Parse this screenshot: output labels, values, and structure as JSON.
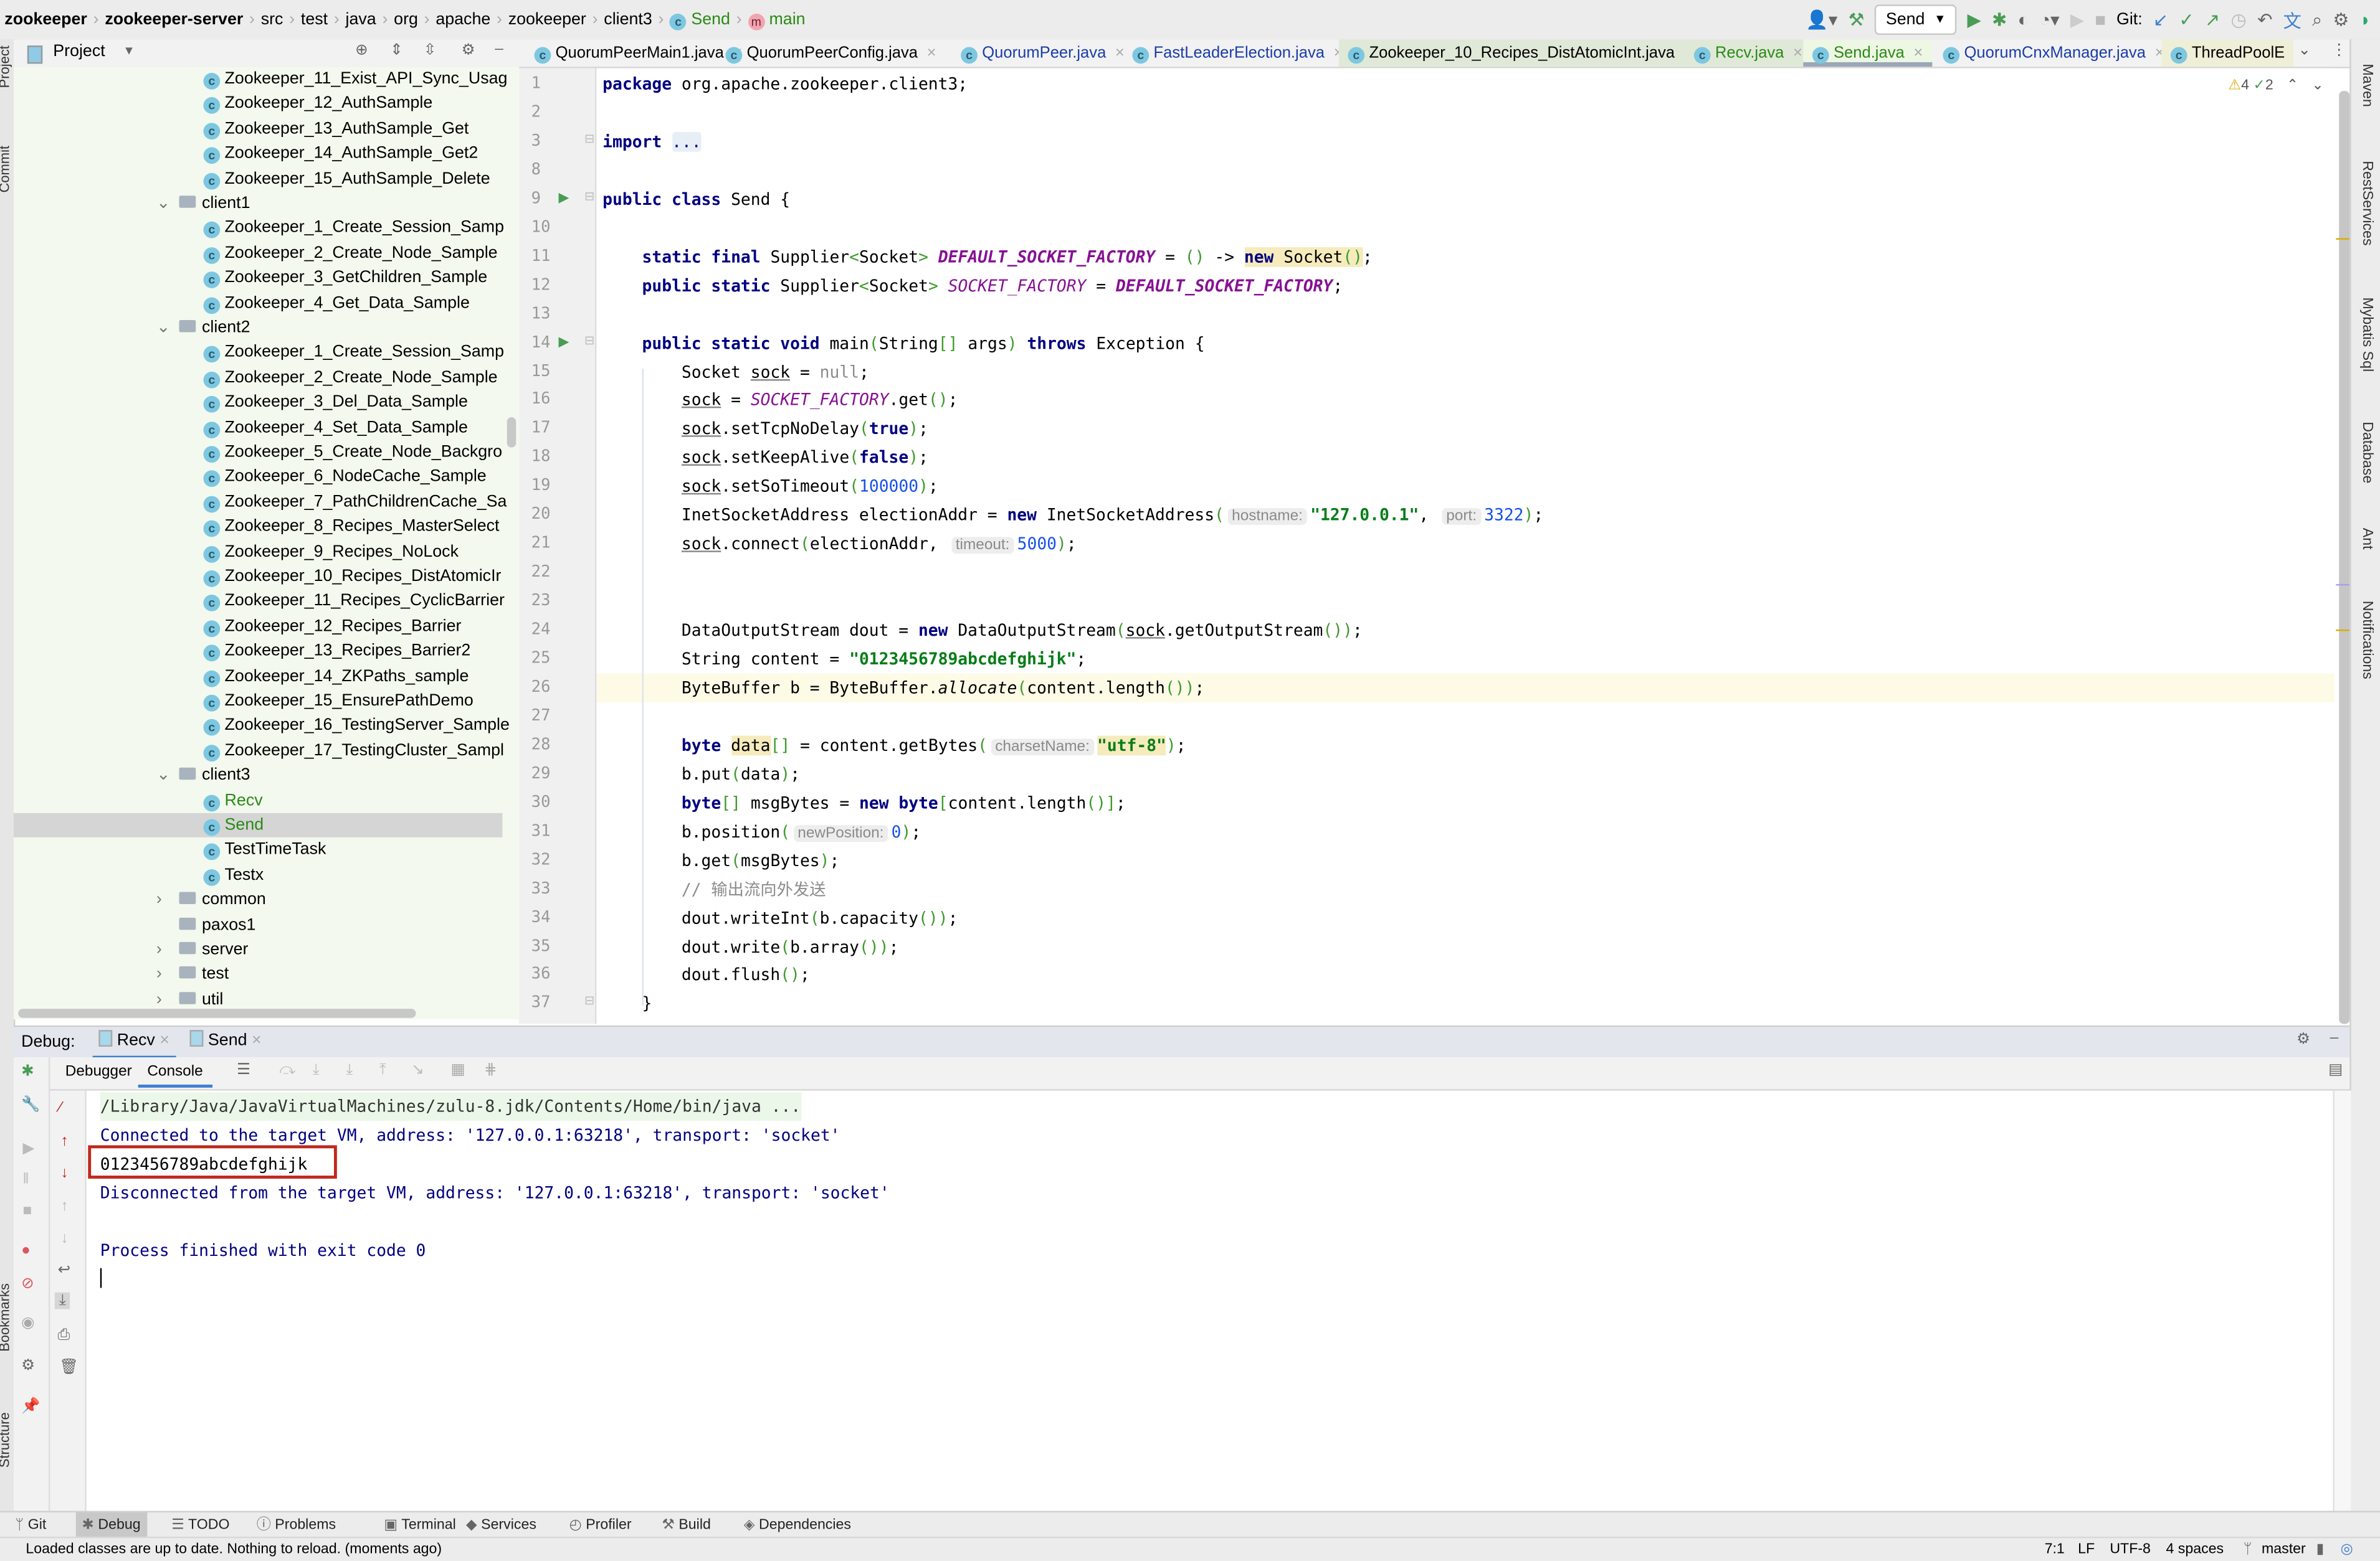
{
  "breadcrumb": [
    "zookeeper",
    "zookeeper-server",
    "src",
    "test",
    "java",
    "org",
    "apache",
    "zookeeper",
    "client3",
    "Send",
    "main"
  ],
  "toolbar": {
    "run_config": "Send",
    "git_label": "Git:"
  },
  "project_panel": {
    "title": "Project"
  },
  "tree": [
    {
      "label": "Zookeeper_11_Exist_API_Sync_Usag",
      "type": "class",
      "level": 2
    },
    {
      "label": "Zookeeper_12_AuthSample",
      "type": "class",
      "level": 2
    },
    {
      "label": "Zookeeper_13_AuthSample_Get",
      "type": "class",
      "level": 2
    },
    {
      "label": "Zookeeper_14_AuthSample_Get2",
      "type": "class",
      "level": 2
    },
    {
      "label": "Zookeeper_15_AuthSample_Delete",
      "type": "class",
      "level": 2
    },
    {
      "label": "client1",
      "type": "folder-open",
      "level": 1
    },
    {
      "label": "Zookeeper_1_Create_Session_Samp",
      "type": "class",
      "level": 2
    },
    {
      "label": "Zookeeper_2_Create_Node_Sample",
      "type": "class",
      "level": 2
    },
    {
      "label": "Zookeeper_3_GetChildren_Sample",
      "type": "class",
      "level": 2
    },
    {
      "label": "Zookeeper_4_Get_Data_Sample",
      "type": "class",
      "level": 2
    },
    {
      "label": "client2",
      "type": "folder-open",
      "level": 1
    },
    {
      "label": "Zookeeper_1_Create_Session_Samp",
      "type": "class",
      "level": 2
    },
    {
      "label": "Zookeeper_2_Create_Node_Sample",
      "type": "class",
      "level": 2
    },
    {
      "label": "Zookeeper_3_Del_Data_Sample",
      "type": "class",
      "level": 2
    },
    {
      "label": "Zookeeper_4_Set_Data_Sample",
      "type": "class",
      "level": 2
    },
    {
      "label": "Zookeeper_5_Create_Node_Backgro",
      "type": "class",
      "level": 2
    },
    {
      "label": "Zookeeper_6_NodeCache_Sample",
      "type": "class",
      "level": 2
    },
    {
      "label": "Zookeeper_7_PathChildrenCache_Sa",
      "type": "class",
      "level": 2
    },
    {
      "label": "Zookeeper_8_Recipes_MasterSelect",
      "type": "class",
      "level": 2
    },
    {
      "label": "Zookeeper_9_Recipes_NoLock",
      "type": "class",
      "level": 2
    },
    {
      "label": "Zookeeper_10_Recipes_DistAtomicIr",
      "type": "class",
      "level": 2
    },
    {
      "label": "Zookeeper_11_Recipes_CyclicBarrier",
      "type": "class",
      "level": 2
    },
    {
      "label": "Zookeeper_12_Recipes_Barrier",
      "type": "class",
      "level": 2
    },
    {
      "label": "Zookeeper_13_Recipes_Barrier2",
      "type": "class",
      "level": 2
    },
    {
      "label": "Zookeeper_14_ZKPaths_sample",
      "type": "class",
      "level": 2
    },
    {
      "label": "Zookeeper_15_EnsurePathDemo",
      "type": "class",
      "level": 2
    },
    {
      "label": "Zookeeper_16_TestingServer_Sample",
      "type": "class",
      "level": 2
    },
    {
      "label": "Zookeeper_17_TestingCluster_Sampl",
      "type": "class",
      "level": 2
    },
    {
      "label": "client3",
      "type": "folder-open",
      "level": 1
    },
    {
      "label": "Recv",
      "type": "class-green",
      "level": 2
    },
    {
      "label": "Send",
      "type": "class-green",
      "level": 2,
      "selected": true
    },
    {
      "label": "TestTimeTask",
      "type": "class",
      "level": 2
    },
    {
      "label": "Testx",
      "type": "class",
      "level": 2
    },
    {
      "label": "common",
      "type": "folder-closed",
      "level": 1
    },
    {
      "label": "paxos1",
      "type": "folder",
      "level": 1
    },
    {
      "label": "server",
      "type": "folder-closed",
      "level": 1
    },
    {
      "label": "test",
      "type": "folder-closed",
      "level": 1
    },
    {
      "label": "util",
      "type": "folder-closed",
      "level": 1
    }
  ],
  "tabs": [
    {
      "label": "QuorumPeerMain1.java",
      "color": "#000000"
    },
    {
      "label": "QuorumPeerConfig.java",
      "color": "#000000"
    },
    {
      "label": "QuorumPeer.java",
      "color": "#1a3da8"
    },
    {
      "label": "FastLeaderElection.java",
      "color": "#1a3da8"
    },
    {
      "label": "Zookeeper_10_Recipes_DistAtomicInt.java",
      "color": "#000000",
      "bg": "#e0e9d8"
    },
    {
      "label": "Recv.java",
      "color": "#2a8a16",
      "bg": "#e0e9d8"
    },
    {
      "label": "Send.java",
      "color": "#2a8a16",
      "active": true
    },
    {
      "label": "QuorumCnxManager.java",
      "color": "#1a3da8"
    },
    {
      "label": "ThreadPoolE",
      "color": "#000000",
      "bg": "#efefd8"
    }
  ],
  "inspections": {
    "warnings": "4",
    "ok": "2"
  },
  "code": [
    {
      "n": "1",
      "t": [
        [
          "package",
          "k"
        ],
        [
          " org.apache.zookeeper.client3;",
          ""
        ]
      ]
    },
    {
      "n": "2",
      "t": []
    },
    {
      "n": "3",
      "t": [
        [
          "import",
          "k"
        ],
        [
          " ",
          ""
        ],
        [
          "...",
          "fold"
        ]
      ]
    },
    {
      "n": "8",
      "t": []
    },
    {
      "n": "9",
      "run": true,
      "t": [
        [
          "public class",
          "k"
        ],
        [
          " Send ",
          ""
        ],
        [
          "{",
          ""
        ]
      ]
    },
    {
      "n": "10",
      "t": []
    },
    {
      "n": "11",
      "t": [
        [
          "    ",
          ""
        ],
        [
          "static final",
          "k"
        ],
        [
          " Supplier",
          ""
        ],
        [
          "<",
          "p"
        ],
        [
          "Socket",
          ""
        ],
        [
          ">",
          "p"
        ],
        [
          " ",
          ""
        ],
        [
          "DEFAULT_SOCKET_FACTORY",
          "fb"
        ],
        [
          " = ",
          ""
        ],
        [
          "()",
          "p"
        ],
        [
          " -> ",
          ""
        ],
        [
          "new",
          "k hl"
        ],
        [
          " Socket",
          "hl"
        ],
        [
          "()",
          "p hl"
        ],
        [
          ";",
          ""
        ]
      ]
    },
    {
      "n": "12",
      "t": [
        [
          "    ",
          ""
        ],
        [
          "public static",
          "k"
        ],
        [
          " Supplier",
          ""
        ],
        [
          "<",
          "p"
        ],
        [
          "Socket",
          ""
        ],
        [
          ">",
          "p"
        ],
        [
          " ",
          ""
        ],
        [
          "SOCKET_FACTORY",
          "f"
        ],
        [
          " = ",
          ""
        ],
        [
          "DEFAULT_SOCKET_FACTORY",
          "fb"
        ],
        [
          ";",
          ""
        ]
      ]
    },
    {
      "n": "13",
      "t": []
    },
    {
      "n": "14",
      "run": true,
      "t": [
        [
          "    ",
          ""
        ],
        [
          "public static void",
          "k"
        ],
        [
          " main",
          ""
        ],
        [
          "(",
          "p"
        ],
        [
          "String",
          ""
        ],
        [
          "[]",
          "p"
        ],
        [
          " args",
          ""
        ],
        [
          ")",
          "p"
        ],
        [
          " ",
          ""
        ],
        [
          "throws",
          "k"
        ],
        [
          " Exception ",
          ""
        ],
        [
          "{",
          ""
        ]
      ]
    },
    {
      "n": "15",
      "t": [
        [
          "        Socket ",
          ""
        ],
        [
          "sock",
          "u"
        ],
        [
          " = ",
          ""
        ],
        [
          "null",
          "nl"
        ],
        [
          ";",
          ""
        ]
      ]
    },
    {
      "n": "16",
      "t": [
        [
          "        ",
          ""
        ],
        [
          "sock",
          "u"
        ],
        [
          " = ",
          ""
        ],
        [
          "SOCKET_FACTORY",
          "f"
        ],
        [
          ".get",
          ""
        ],
        [
          "()",
          "p"
        ],
        [
          ";",
          ""
        ]
      ]
    },
    {
      "n": "17",
      "t": [
        [
          "        ",
          ""
        ],
        [
          "sock",
          "u"
        ],
        [
          ".setTcpNoDelay",
          ""
        ],
        [
          "(",
          "p"
        ],
        [
          "true",
          "k"
        ],
        [
          ")",
          "p"
        ],
        [
          ";",
          ""
        ]
      ]
    },
    {
      "n": "18",
      "t": [
        [
          "        ",
          ""
        ],
        [
          "sock",
          "u"
        ],
        [
          ".setKeepAlive",
          ""
        ],
        [
          "(",
          "p"
        ],
        [
          "false",
          "k"
        ],
        [
          ")",
          "p"
        ],
        [
          ";",
          ""
        ]
      ]
    },
    {
      "n": "19",
      "t": [
        [
          "        ",
          ""
        ],
        [
          "sock",
          "u"
        ],
        [
          ".setSoTimeout",
          ""
        ],
        [
          "(",
          "p"
        ],
        [
          "100000",
          "n"
        ],
        [
          ")",
          "p"
        ],
        [
          ";",
          ""
        ]
      ]
    },
    {
      "n": "20",
      "t": [
        [
          "        InetSocketAddress electionAddr = ",
          ""
        ],
        [
          "new",
          "k"
        ],
        [
          " InetSocketAddress",
          ""
        ],
        [
          "(",
          "p"
        ],
        [
          "hostname:",
          "h"
        ],
        [
          "\"127.0.0.1\"",
          "s"
        ],
        [
          ", ",
          ""
        ],
        [
          "port:",
          "h"
        ],
        [
          "3322",
          "n"
        ],
        [
          ")",
          "p"
        ],
        [
          ";",
          ""
        ]
      ]
    },
    {
      "n": "21",
      "t": [
        [
          "        ",
          ""
        ],
        [
          "sock",
          "u"
        ],
        [
          ".connect",
          ""
        ],
        [
          "(",
          "p"
        ],
        [
          "electionAddr, ",
          ""
        ],
        [
          "timeout:",
          "h"
        ],
        [
          "5000",
          "n"
        ],
        [
          ")",
          "p"
        ],
        [
          ";",
          ""
        ]
      ]
    },
    {
      "n": "22",
      "t": []
    },
    {
      "n": "23",
      "t": []
    },
    {
      "n": "24",
      "t": [
        [
          "        DataOutputStream dout = ",
          ""
        ],
        [
          "new",
          "k"
        ],
        [
          " DataOutputStream",
          ""
        ],
        [
          "(",
          "p"
        ],
        [
          "sock",
          "u"
        ],
        [
          ".getOutputStream",
          ""
        ],
        [
          "()",
          "p"
        ],
        [
          ")",
          "p"
        ],
        [
          ";",
          ""
        ]
      ]
    },
    {
      "n": "25",
      "t": [
        [
          "        String content = ",
          ""
        ],
        [
          "\"0123456789abcdefghijk\"",
          "s"
        ],
        [
          ";",
          ""
        ]
      ]
    },
    {
      "n": "26",
      "cur": true,
      "bulb": true,
      "t": [
        [
          "        ByteBuffer b = ByteBuffer.",
          ""
        ],
        [
          "allocate",
          "i"
        ],
        [
          "(",
          "p"
        ],
        [
          "content.length",
          ""
        ],
        [
          "()",
          "p"
        ],
        [
          ")",
          "p"
        ],
        [
          ";",
          ""
        ]
      ]
    },
    {
      "n": "27",
      "t": []
    },
    {
      "n": "28",
      "t": [
        [
          "        ",
          ""
        ],
        [
          "byte",
          "k"
        ],
        [
          " ",
          ""
        ],
        [
          "data",
          "hl"
        ],
        [
          "[]",
          "p"
        ],
        [
          " = content.getBytes",
          ""
        ],
        [
          "(",
          "p"
        ],
        [
          "charsetName:",
          "h"
        ],
        [
          "\"utf-8\"",
          "s hl"
        ],
        [
          ")",
          "p"
        ],
        [
          ";",
          ""
        ]
      ]
    },
    {
      "n": "29",
      "t": [
        [
          "        b.put",
          ""
        ],
        [
          "(",
          "p"
        ],
        [
          "data",
          ""
        ],
        [
          ")",
          "p"
        ],
        [
          ";",
          ""
        ]
      ]
    },
    {
      "n": "30",
      "t": [
        [
          "        ",
          ""
        ],
        [
          "byte",
          "k"
        ],
        [
          "[]",
          "p"
        ],
        [
          " msgBytes = ",
          ""
        ],
        [
          "new byte",
          "k"
        ],
        [
          "[",
          "p"
        ],
        [
          "content.length",
          ""
        ],
        [
          "()",
          "p"
        ],
        [
          "]",
          "p"
        ],
        [
          ";",
          ""
        ]
      ]
    },
    {
      "n": "31",
      "t": [
        [
          "        b.position",
          ""
        ],
        [
          "(",
          "p"
        ],
        [
          "newPosition:",
          "h"
        ],
        [
          "0",
          "n"
        ],
        [
          ")",
          "p"
        ],
        [
          ";",
          ""
        ]
      ]
    },
    {
      "n": "32",
      "t": [
        [
          "        b.get",
          ""
        ],
        [
          "(",
          "p"
        ],
        [
          "msgBytes",
          ""
        ],
        [
          ")",
          "p"
        ],
        [
          ";",
          ""
        ]
      ]
    },
    {
      "n": "33",
      "t": [
        [
          "        // 输出流向外发送",
          "c"
        ]
      ]
    },
    {
      "n": "34",
      "t": [
        [
          "        dout.writeInt",
          ""
        ],
        [
          "(",
          "p"
        ],
        [
          "b.capacity",
          ""
        ],
        [
          "()",
          "p"
        ],
        [
          ")",
          "p"
        ],
        [
          ";",
          ""
        ]
      ]
    },
    {
      "n": "35",
      "t": [
        [
          "        dout.write",
          ""
        ],
        [
          "(",
          "p"
        ],
        [
          "b.array",
          ""
        ],
        [
          "()",
          "p"
        ],
        [
          ")",
          "p"
        ],
        [
          ";",
          ""
        ]
      ]
    },
    {
      "n": "36",
      "t": [
        [
          "        dout.flush",
          ""
        ],
        [
          "()",
          "p"
        ],
        [
          ";",
          ""
        ]
      ]
    },
    {
      "n": "37",
      "t": [
        [
          "    }",
          ""
        ]
      ]
    }
  ],
  "debug": {
    "label": "Debug:",
    "sessions": [
      "Recv",
      "Send"
    ],
    "subtabs": [
      "Debugger",
      "Console"
    ]
  },
  "console": [
    {
      "text": "/Library/Java/JavaVirtualMachines/zulu-8.jdk/Contents/Home/bin/java ...",
      "kind": "cmd"
    },
    {
      "text": "Connected to the target VM, address: '127.0.0.1:63218', transport: 'socket'",
      "kind": "sys"
    },
    {
      "text": "0123456789abcdefghijk",
      "kind": "out",
      "boxed": true
    },
    {
      "text": "Disconnected from the target VM, address: '127.0.0.1:63218', transport: 'socket'",
      "kind": "sys"
    },
    {
      "text": "",
      "kind": "sys"
    },
    {
      "text": "Process finished with exit code 0",
      "kind": "sys"
    }
  ],
  "bottom_tools": [
    "Git",
    "Debug",
    "TODO",
    "Problems",
    "Terminal",
    "Services",
    "Profiler",
    "Build",
    "Dependencies"
  ],
  "right_tools": [
    "Maven",
    "RestServices",
    "Mybatis Sql",
    "Database",
    "Ant",
    "Notifications"
  ],
  "left_tools": [
    "Project",
    "Commit",
    "Bookmarks",
    "Structure"
  ],
  "status": {
    "message": "Loaded classes are up to date. Nothing to reload. (moments ago)",
    "position": "7:1",
    "line_sep": "LF",
    "encoding": "UTF-8",
    "indent": "4 spaces",
    "branch": "master"
  },
  "colors": {
    "accent": "#3f7fd0",
    "highlight_box": "#c0291e",
    "run_green": "#499c54"
  }
}
